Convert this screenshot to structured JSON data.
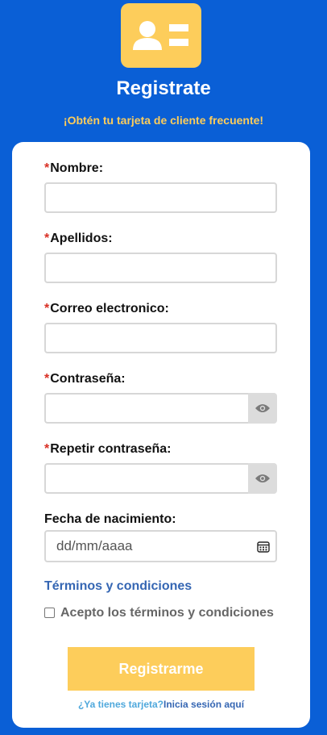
{
  "header": {
    "logo_icon": "id-card-icon",
    "title": "Registrate",
    "subtitle": "¡Obtén tu tarjeta de cliente frecuente!"
  },
  "form": {
    "required_mark": "*",
    "fields": {
      "nombre": {
        "label": "Nombre:",
        "value": "",
        "required": true
      },
      "apellidos": {
        "label": "Apellidos:",
        "value": "",
        "required": true
      },
      "correo": {
        "label": "Correo electronico:",
        "value": "",
        "required": true
      },
      "contrasena": {
        "label": "Contraseña:",
        "value": "",
        "required": true,
        "toggle_icon": "eye-icon"
      },
      "repetir": {
        "label": "Repetir contraseña:",
        "value": "",
        "required": true,
        "toggle_icon": "eye-icon"
      },
      "fecha": {
        "label": "Fecha de nacimiento:",
        "placeholder": "dd/mm/aaaa",
        "value": "",
        "icon": "calendar-icon"
      }
    },
    "terms_link": "Términos y condiciones",
    "accept_label": "Acepto los términos y condiciones",
    "accept_checked": false,
    "submit_label": "Registrarme",
    "login_question": "¿Ya tienes tarjeta?",
    "login_link": "Inicia sesión aquí"
  },
  "colors": {
    "background": "#0a5fd6",
    "accent": "#fdcd5b",
    "required": "#d93025",
    "link": "#3566b3",
    "link_light": "#4fa8dc"
  }
}
